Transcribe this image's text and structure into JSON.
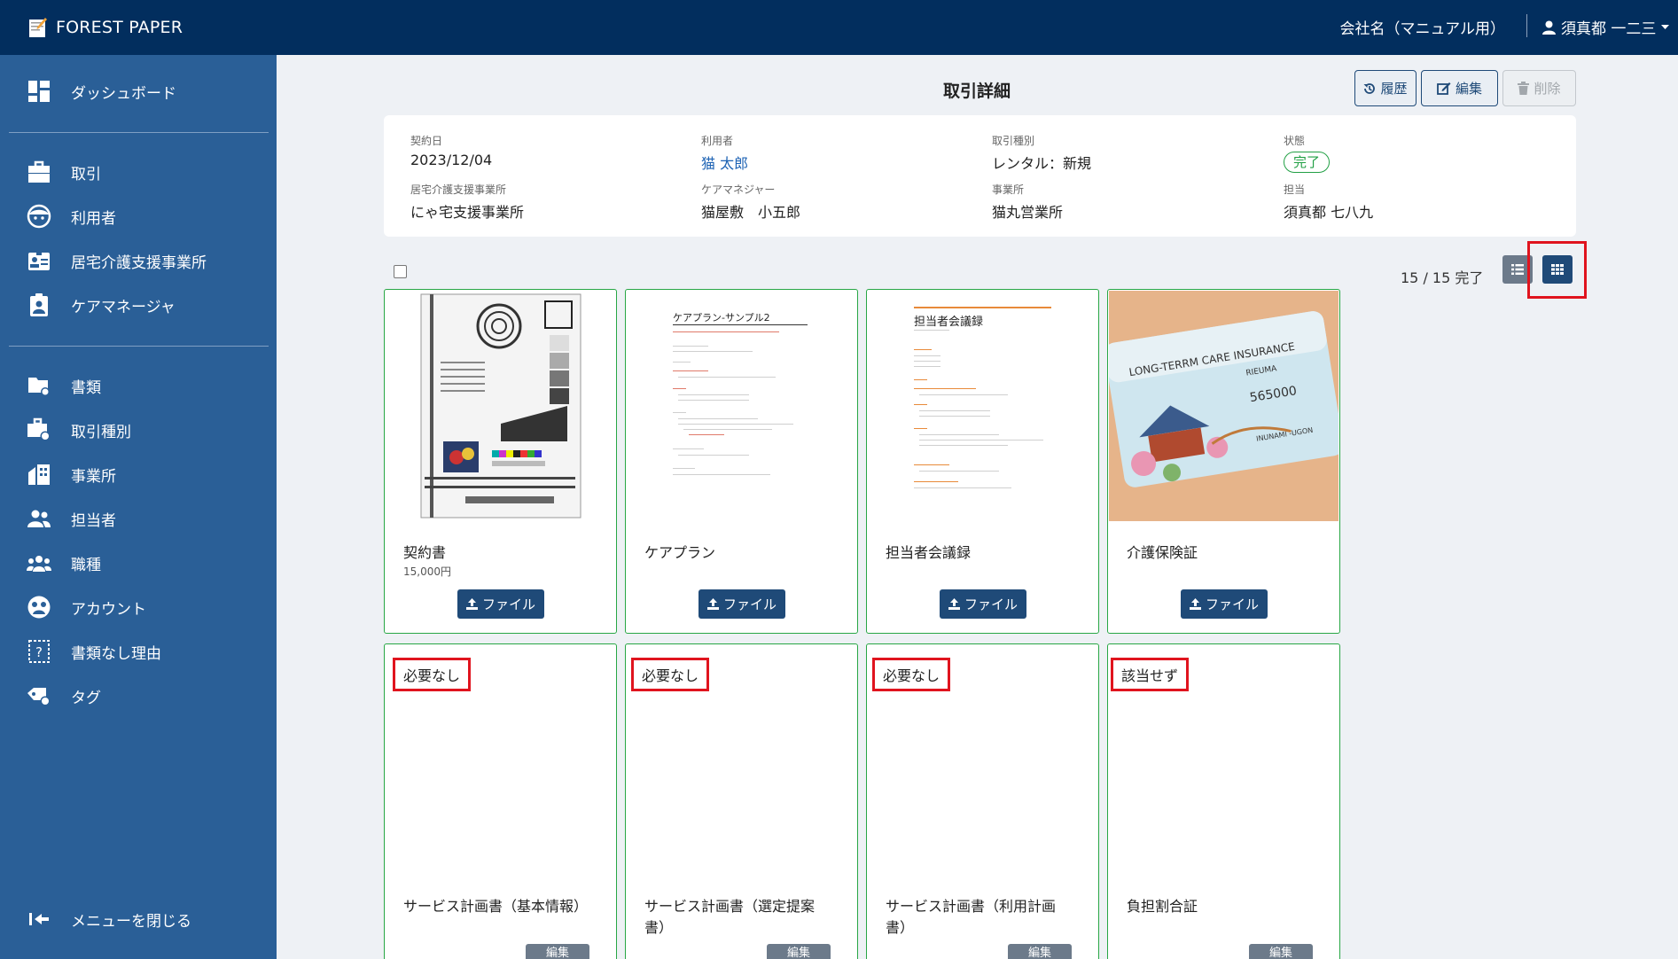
{
  "app": {
    "brand": "FOREST PAPER",
    "company": "会社名（マニュアル用）",
    "user": "須真都 一二三"
  },
  "sidebar": {
    "items": [
      {
        "label": "ダッシュボード",
        "icon": "dashboard-icon"
      },
      {
        "label": "取引",
        "icon": "briefcase-icon"
      },
      {
        "label": "利用者",
        "icon": "face-icon"
      },
      {
        "label": "居宅介護支援事業所",
        "icon": "contact-card-icon"
      },
      {
        "label": "ケアマネージャ",
        "icon": "clipboard-user-icon"
      },
      {
        "label": "書類",
        "icon": "folder-gear-icon"
      },
      {
        "label": "取引種別",
        "icon": "briefcase-gear-icon"
      },
      {
        "label": "事業所",
        "icon": "building-icon"
      },
      {
        "label": "担当者",
        "icon": "people-icon"
      },
      {
        "label": "職種",
        "icon": "group-icon"
      },
      {
        "label": "アカウント",
        "icon": "account-circle-icon"
      },
      {
        "label": "書類なし理由",
        "icon": "question-box-icon"
      },
      {
        "label": "タグ",
        "icon": "tag-icon"
      }
    ],
    "close_label": "メニューを閉じる"
  },
  "page": {
    "title": "取引詳細",
    "buttons": {
      "history": "履歴",
      "edit": "編集",
      "delete": "削除"
    }
  },
  "info": {
    "contract_date": {
      "label": "契約日",
      "value": "2023/12/04"
    },
    "client": {
      "label": "利用者",
      "value": "猫 太郎"
    },
    "transaction_type": {
      "label": "取引種別",
      "value": "レンタル：新規"
    },
    "status": {
      "label": "状態",
      "value": "完了"
    },
    "care_office": {
      "label": "居宅介護支援事業所",
      "value": "にゃ宅支援事業所"
    },
    "care_manager": {
      "label": "ケアマネジャー",
      "value": "猫屋敷　小五郎"
    },
    "office": {
      "label": "事業所",
      "value": "猫丸営業所"
    },
    "staff": {
      "label": "担当",
      "value": "須真都 七八九"
    }
  },
  "documents": {
    "progress": "15 / 15 完了",
    "file_button": "ファイル",
    "edit_button": "編集",
    "cards": [
      {
        "title": "契約書",
        "amount": "15,000円"
      },
      {
        "title": "ケアプラン"
      },
      {
        "title": "担当者会議録"
      },
      {
        "title": "介護保険証"
      },
      {
        "title": "サービス計画書（基本情報）",
        "tag": "必要なし"
      },
      {
        "title": "サービス計画書（選定提案書）",
        "tag": "必要なし"
      },
      {
        "title": "サービス計画書（利用計画書）",
        "tag": "必要なし"
      },
      {
        "title": "負担割合証",
        "tag": "該当せず"
      }
    ],
    "thumbs": {
      "careplan_title": "ケアプラン-サンプル2",
      "meeting_title": "担当者会議録",
      "insurance_text1": "LONG-TERRM CARE INSURANCE",
      "insurance_text2": "RIEUMA",
      "insurance_text3": "565000",
      "insurance_text4": "INUNAMI -UGON"
    }
  },
  "colors": {
    "topbar": "#022e5e",
    "sidebar": "#2a5f97",
    "accent": "#1f4a78",
    "success": "#28a745",
    "highlight": "#e0141e"
  }
}
